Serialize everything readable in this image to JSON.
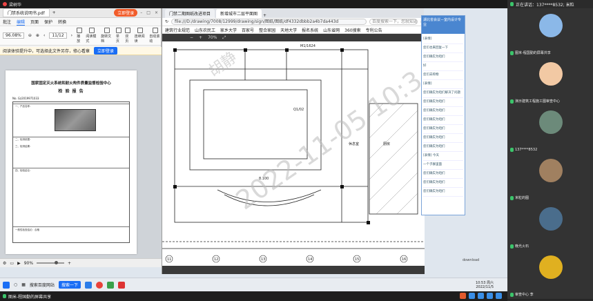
{
  "meeting_top": {
    "title": "梁树华"
  },
  "pdf": {
    "tab_label": "门禁系统说明书.pdf",
    "login_btn": "立即登录",
    "menu": [
      "批注",
      "编辑",
      "页面",
      "保护",
      "转换"
    ],
    "menu_active": 1,
    "tools": [
      "播放",
      "阅读模式",
      "旋转文档",
      "单页",
      "双页",
      "连续阅读",
      "自动滚动"
    ],
    "zoom_value": "96.08%",
    "page_indicator": "11/12",
    "notice_text": "阅读体验提升中，可选择此文件另存，修心看章",
    "notice_btn": "立即登录",
    "doc_title": "国家固定灭火系统和耐火构件质量监督检验中心",
    "doc_subtitle": "检 验 报 告",
    "doc_no": "No. Gz2019971033",
    "doc_lines": [
      "一、产品名称：",
      "二、检测依据：",
      "三、检测结果：",
      "四、检验结论：",
      "一般性检查结论：合格"
    ],
    "status_zoom": "90%",
    "zoom_fraction": 0.72
  },
  "browser": {
    "tabs": [
      "门禁二期图纸改进项目",
      "新增城市二层平面图"
    ],
    "active_tab": 1,
    "url": "file:///D:/drawing/7008/12999/drawing/sign/图纸/图纸/df4332dbbb2a4b7da443d",
    "search_placeholder": "百度搜索一下，您就知道",
    "bookmarks": [
      "建筑行业规范",
      "山东农民工",
      "家乡大学",
      "百家号",
      "整合家园",
      "天地大学",
      "报名系统",
      "山东省网",
      "360搜索",
      "专利公告"
    ],
    "cad_zoom": "70%",
    "cad_watermark": "2022-11-05 10:3",
    "cad_watermark2": "胡静",
    "cad_labels": [
      "M1/1624",
      "Q1/02",
      "8.100",
      "厨房",
      "休息室"
    ],
    "axis_labels": [
      "11",
      "12",
      "13",
      "14",
      "15",
      "16"
    ]
  },
  "chat": {
    "header_title": "湖北省会议—室内设计专业",
    "items": [
      "[表情]",
      "您们也来回复一下",
      "您们确实为咱们",
      "好",
      "您们去购物",
      "[表情]",
      "您们确实为咱们解决了问题",
      "您们确实为咱们",
      "您们确实为咱们",
      "您们确实为咱们",
      "您们确实为咱们",
      "您们确实为咱们",
      "您们确实为咱们",
      "[表情] 今天",
      "一个子群里面",
      "您们确实为咱们",
      "您们确实为咱们",
      "您们确实为咱们"
    ]
  },
  "download_label": "download",
  "taskbar": {
    "search_btn": "搜索一下",
    "app_label": "搜索百度网站",
    "clock_time": "10:53 周六",
    "clock_date": "2022/11/5"
  },
  "share_bar": {
    "text": "图米-程国勤的屏幕共享"
  },
  "participants": {
    "speaking": "正在讲话：137****8532; 米粒",
    "tiles": [
      {
        "name": "图米-程国勤的屏幕共享",
        "avatar_color": "#8bb8e8"
      },
      {
        "name": "演示建筑工程施工图审查中心",
        "avatar_color": "#f2c9a4"
      },
      {
        "name": "137****8532",
        "avatar_color": "#6c8a7a"
      },
      {
        "name": "米粒的图",
        "avatar_color": "#a08060"
      },
      {
        "name": "晚光火石",
        "avatar_color": "#4a6d8c"
      },
      {
        "name": "审查中心 李",
        "avatar_color": "#e0b020"
      }
    ]
  },
  "colors": {
    "accent": "#1a6ef5",
    "login_orange": "#f25c2a",
    "mic_green": "#3cc46b"
  }
}
